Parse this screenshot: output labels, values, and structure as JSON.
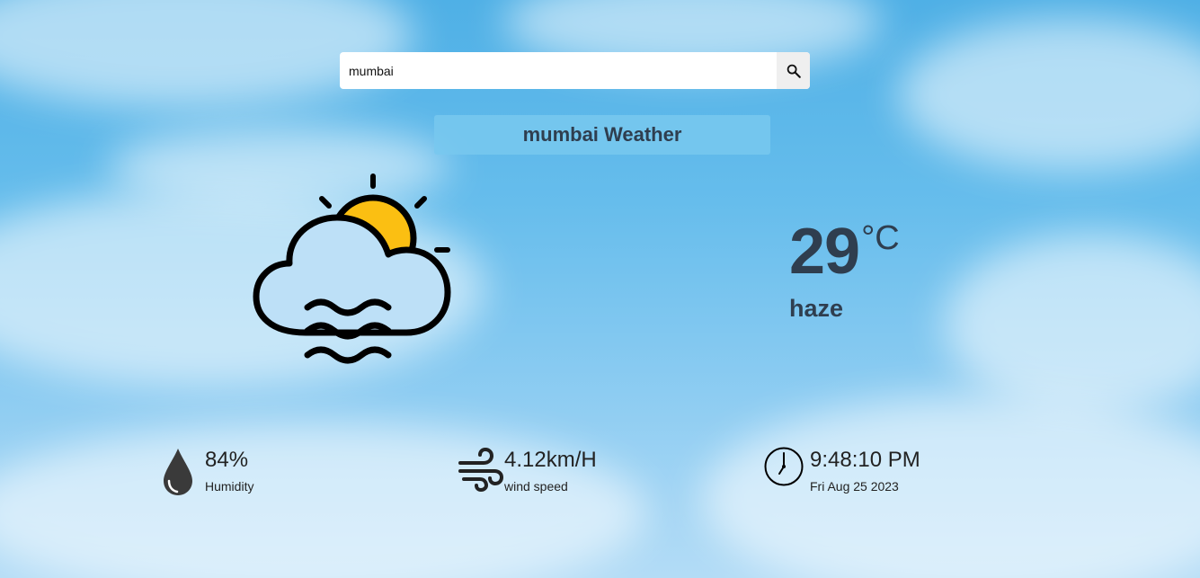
{
  "search": {
    "value": "mumbai",
    "button_icon": "search-icon"
  },
  "title": "mumbai Weather",
  "weather": {
    "icon": "cloud-sun-haze-icon",
    "temperature": "29",
    "unit": "°C",
    "condition": "haze"
  },
  "stats": {
    "humidity": {
      "value": "84%",
      "label": "Humidity",
      "icon": "water-drop-icon"
    },
    "wind": {
      "value": "4.12km/H",
      "label": "wind speed",
      "icon": "wind-icon"
    },
    "time": {
      "value": "9:48:10 PM",
      "label": "Fri Aug 25 2023",
      "icon": "clock-icon"
    }
  },
  "colors": {
    "sun": "#fbbf12",
    "cloud_fill": "#bde0f7",
    "text_dark": "#2f3e4f"
  }
}
